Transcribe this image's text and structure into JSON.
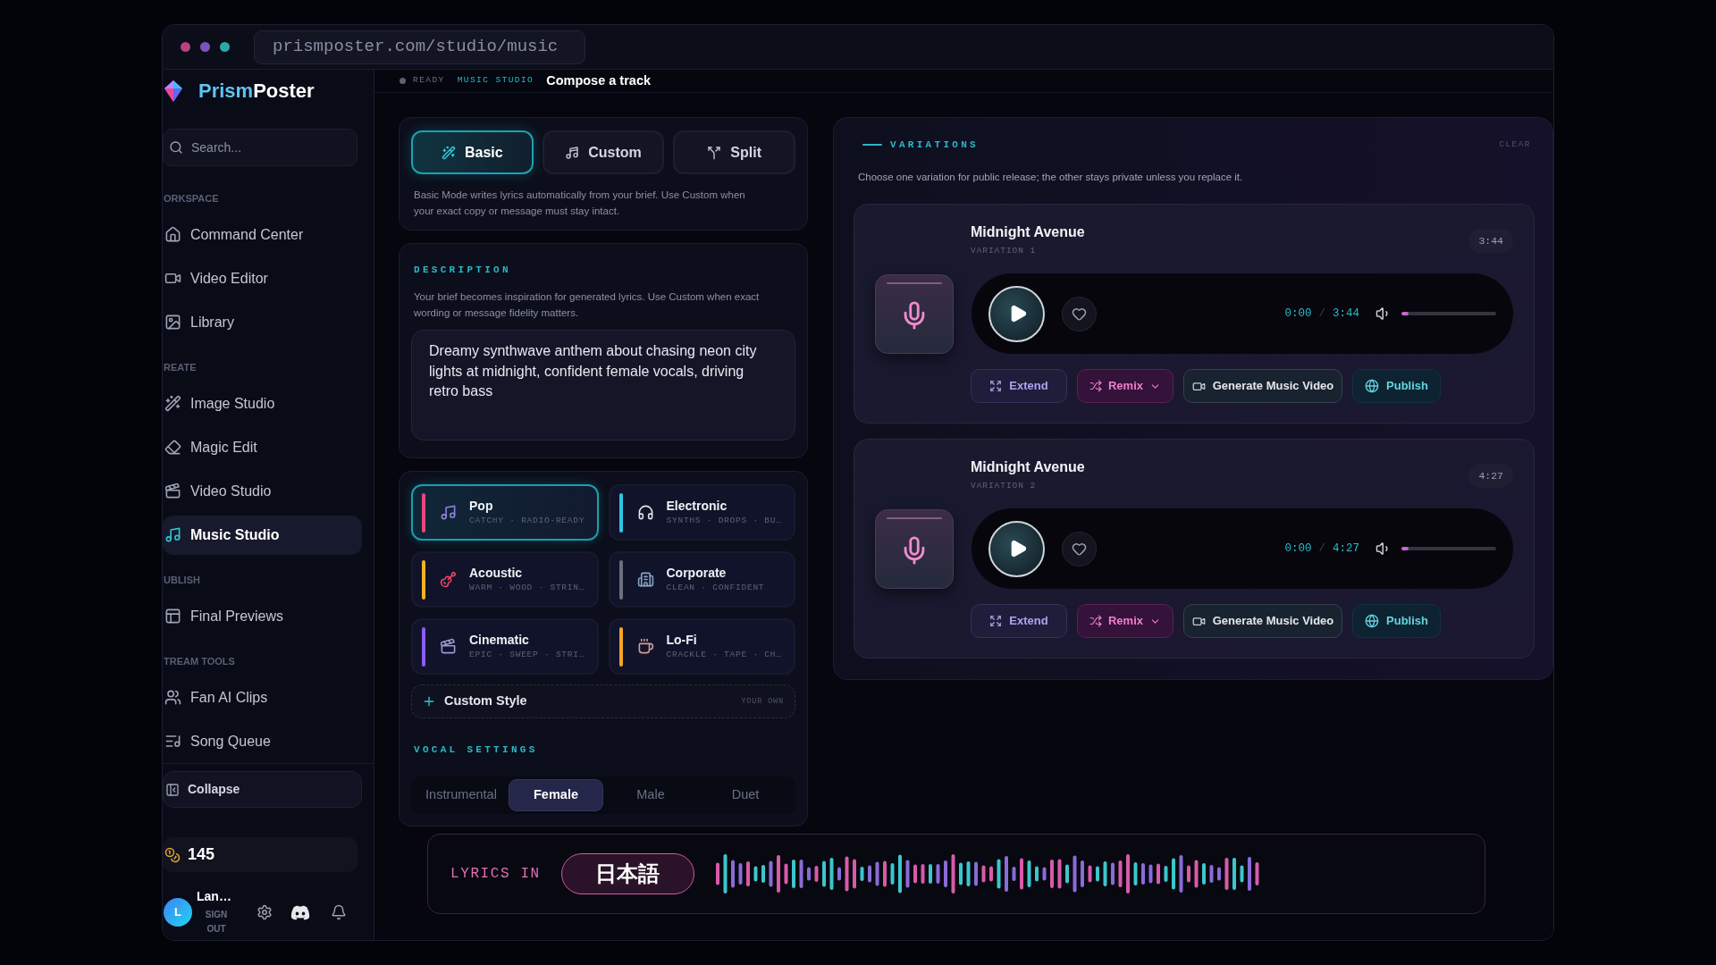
{
  "window": {
    "controls": [
      {
        "color": "#b8417f"
      },
      {
        "color": "#7b55bd"
      },
      {
        "color": "#2ba9a9"
      }
    ],
    "url": "prismposter.com/studio/music"
  },
  "header": {
    "status": "READY",
    "section": "MUSIC STUDIO",
    "page": "Compose a track"
  },
  "sidebar": {
    "brand": {
      "first": "Prism",
      "second": "Poster"
    },
    "search": {
      "placeholder": "Search..."
    },
    "sections": [
      {
        "title": "ORKSPACE",
        "items": [
          {
            "label": "Command Center",
            "selected": false
          },
          {
            "label": "Video Editor",
            "selected": false
          },
          {
            "label": "Library",
            "selected": false
          }
        ]
      },
      {
        "title": "REATE",
        "items": [
          {
            "label": "Image Studio",
            "selected": false
          },
          {
            "label": "Magic Edit",
            "selected": false
          },
          {
            "label": "Video Studio",
            "selected": false
          },
          {
            "label": "Music Studio",
            "selected": true
          }
        ]
      },
      {
        "title": "UBLISH",
        "items": [
          {
            "label": "Final Previews",
            "selected": false
          }
        ]
      },
      {
        "title": "TREAM TOOLS",
        "items": [
          {
            "label": "Fan AI Clips",
            "selected": false
          },
          {
            "label": "Song Queue",
            "selected": false
          }
        ]
      }
    ],
    "collapse": "Collapse",
    "credits": "145",
    "user": {
      "initial": "L",
      "name": "Lan…",
      "sign_out": "SIGN OUT"
    }
  },
  "compose": {
    "modes": [
      {
        "label": "Basic",
        "selected": true
      },
      {
        "label": "Custom",
        "selected": false
      },
      {
        "label": "Split",
        "selected": false
      }
    ],
    "mode_hint": "Basic Mode writes lyrics automatically from your brief. Use Custom when your exact copy or message must stay intact.",
    "description": {
      "title": "DESCRIPTION",
      "hint": "Your brief becomes inspiration for generated lyrics. Use Custom when exact wording or message fidelity matters.",
      "value": "Dreamy synthwave anthem about chasing neon city lights at midnight, confident female vocals, driving retro bass"
    },
    "styles": [
      {
        "name": "Pop",
        "tags": "CATCHY · RADIO-READY",
        "color": "#e8467c",
        "selected": true
      },
      {
        "name": "Electronic",
        "tags": "SYNTHS · DROPS · BU…",
        "color": "#2fc6e6",
        "selected": false
      },
      {
        "name": "Acoustic",
        "tags": "WARM · WOOD · STRIN…",
        "color": "#f2b227",
        "selected": false
      },
      {
        "name": "Corporate",
        "tags": "CLEAN · CONFIDENT",
        "color": "#6b7080",
        "selected": false
      },
      {
        "name": "Cinematic",
        "tags": "EPIC · SWEEP · STRI…",
        "color": "#8b5cf6",
        "selected": false
      },
      {
        "name": "Lo-Fi",
        "tags": "CRACKLE · TAPE · CH…",
        "color": "#f5a524",
        "selected": false
      }
    ],
    "custom_style": {
      "label": "Custom Style",
      "note": "YOUR OWN"
    },
    "vocal": {
      "title": "VOCAL SETTINGS",
      "options": [
        {
          "label": "Instrumental",
          "selected": false
        },
        {
          "label": "Female",
          "selected": true
        },
        {
          "label": "Male",
          "selected": false
        },
        {
          "label": "Duet",
          "selected": false
        }
      ]
    }
  },
  "lyrics_bar": {
    "label": "LYRICS IN",
    "language": "日本語"
  },
  "variations": {
    "title": "VARIATIONS",
    "clear": "CLEAR",
    "hint": "Choose one variation for public release; the other stays private unless you replace it.",
    "items": [
      {
        "title": "Midnight Avenue",
        "subtitle": "VARIATION 1",
        "duration": "3:44",
        "playing": false,
        "liked": false,
        "elapsed": "0:00",
        "separator": "/",
        "total": "3:44",
        "level": 0.08,
        "actions": {
          "extend": "Extend",
          "remix": "Remix",
          "video": "Generate Music Video",
          "publish": "Publish"
        }
      },
      {
        "title": "Midnight Avenue",
        "subtitle": "VARIATION 2",
        "duration": "4:27",
        "playing": false,
        "liked": false,
        "elapsed": "0:00",
        "separator": "/",
        "total": "4:27",
        "level": 0.08,
        "actions": {
          "extend": "Extend",
          "remix": "Remix",
          "video": "Generate Music Video",
          "publish": "Publish"
        }
      }
    ]
  }
}
